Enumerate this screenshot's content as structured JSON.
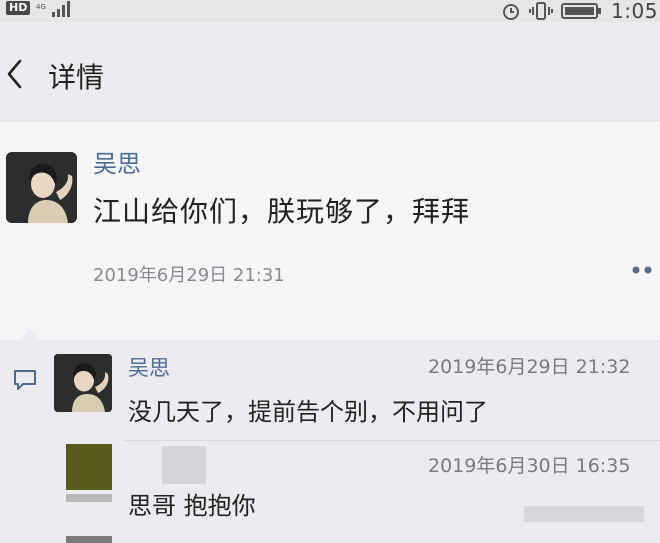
{
  "status_bar": {
    "network": "HD",
    "signal_text": "4G",
    "time": "1:05"
  },
  "header": {
    "title": "详情"
  },
  "post": {
    "author": "吴思",
    "text": "江山给你们，朕玩够了，拜拜",
    "time": "2019年6月29日 21:31"
  },
  "comments": [
    {
      "author": "吴思",
      "time": "2019年6月29日 21:32",
      "text": "没几天了，提前告个别，不用问了"
    },
    {
      "author": "",
      "time": "2019年6月30日 16:35",
      "text": "思哥 抱抱你"
    }
  ],
  "colors": {
    "link_blue": "#4f6b93",
    "page_bg": "#ececf0",
    "post_bg": "#f6f6f8"
  }
}
